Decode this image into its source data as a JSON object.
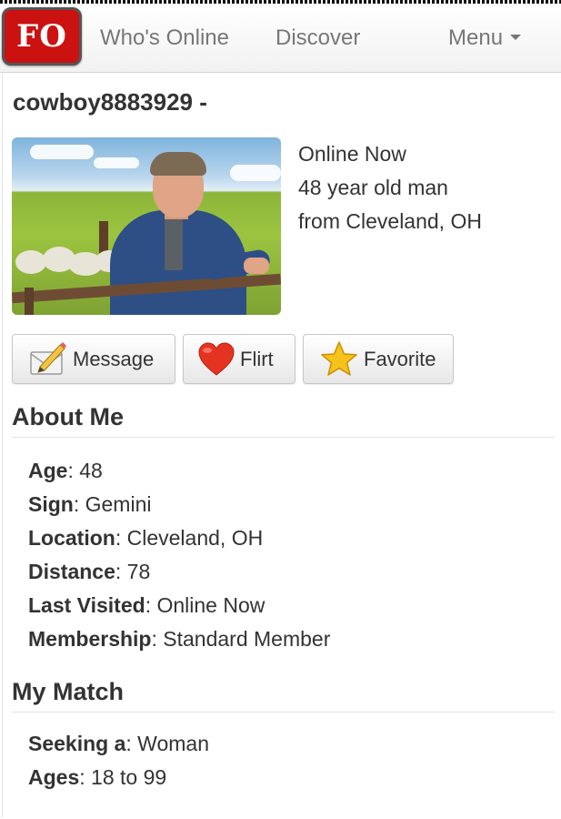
{
  "nav": {
    "logo_text": "FO",
    "whos_online": "Who's Online",
    "discover": "Discover",
    "menu": "Menu"
  },
  "profile": {
    "username": "cowboy8883929 -",
    "status": "Online Now",
    "summary": "48 year old man",
    "from": "from Cleveland, OH"
  },
  "actions": {
    "message": "Message",
    "flirt": "Flirt",
    "favorite": "Favorite"
  },
  "about": {
    "title": "About Me",
    "fields": [
      {
        "label": "Age",
        "value": ": 48"
      },
      {
        "label": "Sign",
        "value": ": Gemini"
      },
      {
        "label": "Location",
        "value": ": Cleveland, OH"
      },
      {
        "label": "Distance",
        "value": ": 78"
      },
      {
        "label": "Last Visited",
        "value": ": Online Now"
      },
      {
        "label": "Membership",
        "value": ": Standard Member"
      }
    ]
  },
  "match": {
    "title": "My Match",
    "fields": [
      {
        "label": "Seeking a",
        "value": ": Woman"
      },
      {
        "label": "Ages",
        "value": ": 18 to 99"
      }
    ]
  },
  "colors": {
    "logo_red": "#cc1111",
    "heart_red": "#e53322",
    "star_yellow": "#f6c21b"
  }
}
